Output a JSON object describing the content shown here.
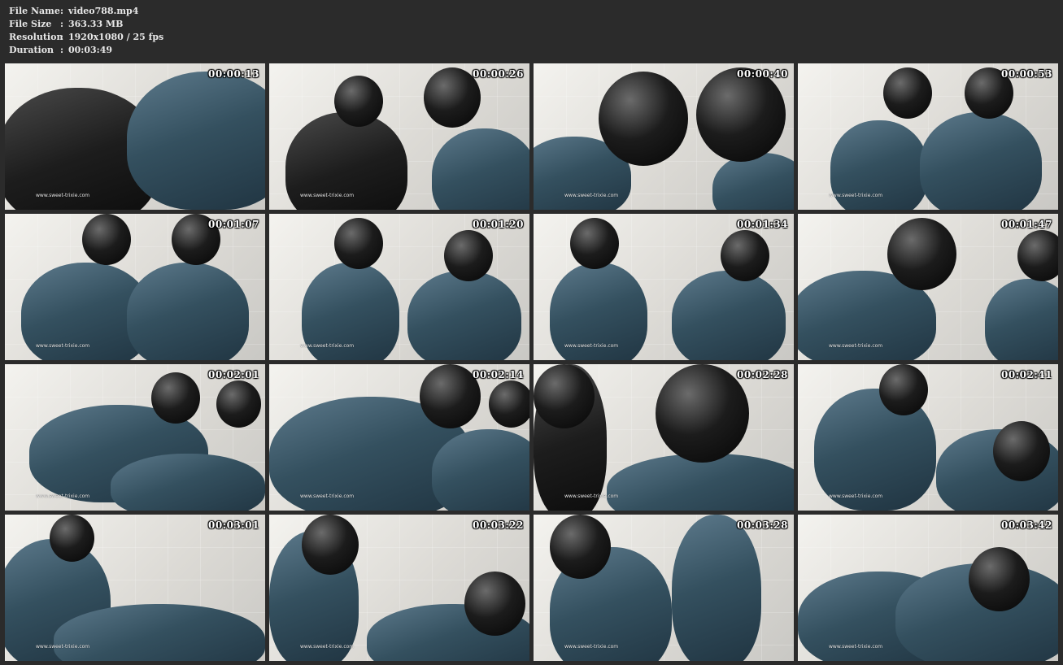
{
  "header": {
    "rows": [
      {
        "label": "File Name",
        "sep": ":",
        "value": "video788.mp4"
      },
      {
        "label": "File Size",
        "sep": ":",
        "value": "363.33 MB"
      },
      {
        "label": "Resolution",
        "sep": ":",
        "value": "1920x1080 / 25 fps"
      },
      {
        "label": "Duration",
        "sep": ":",
        "value": "00:03:49"
      }
    ]
  },
  "colors": {
    "background": "#2b2b2b",
    "header_text": "#e8e8e8",
    "timestamp_text": "#ffffff"
  },
  "thumbnails": [
    {
      "time": "00:00:13",
      "watermark": "www.sweet-trixie.com"
    },
    {
      "time": "00:00:26",
      "watermark": "www.sweet-trixie.com"
    },
    {
      "time": "00:00:40",
      "watermark": "www.sweet-trixie.com"
    },
    {
      "time": "00:00:53",
      "watermark": "www.sweet-trixie.com"
    },
    {
      "time": "00:01:07",
      "watermark": "www.sweet-trixie.com"
    },
    {
      "time": "00:01:20",
      "watermark": "www.sweet-trixie.com"
    },
    {
      "time": "00:01:34",
      "watermark": "www.sweet-trixie.com"
    },
    {
      "time": "00:01:47",
      "watermark": "www.sweet-trixie.com"
    },
    {
      "time": "00:02:01",
      "watermark": "www.sweet-trixie.com"
    },
    {
      "time": "00:02:14",
      "watermark": "www.sweet-trixie.com"
    },
    {
      "time": "00:02:28",
      "watermark": "www.sweet-trixie.com"
    },
    {
      "time": "00:02:41",
      "watermark": "www.sweet-trixie.com"
    },
    {
      "time": "00:03:01",
      "watermark": "www.sweet-trixie.com"
    },
    {
      "time": "00:03:22",
      "watermark": "www.sweet-trixie.com"
    },
    {
      "time": "00:03:28",
      "watermark": "www.sweet-trixie.com"
    },
    {
      "time": "00:03:42",
      "watermark": "www.sweet-trixie.com"
    }
  ]
}
